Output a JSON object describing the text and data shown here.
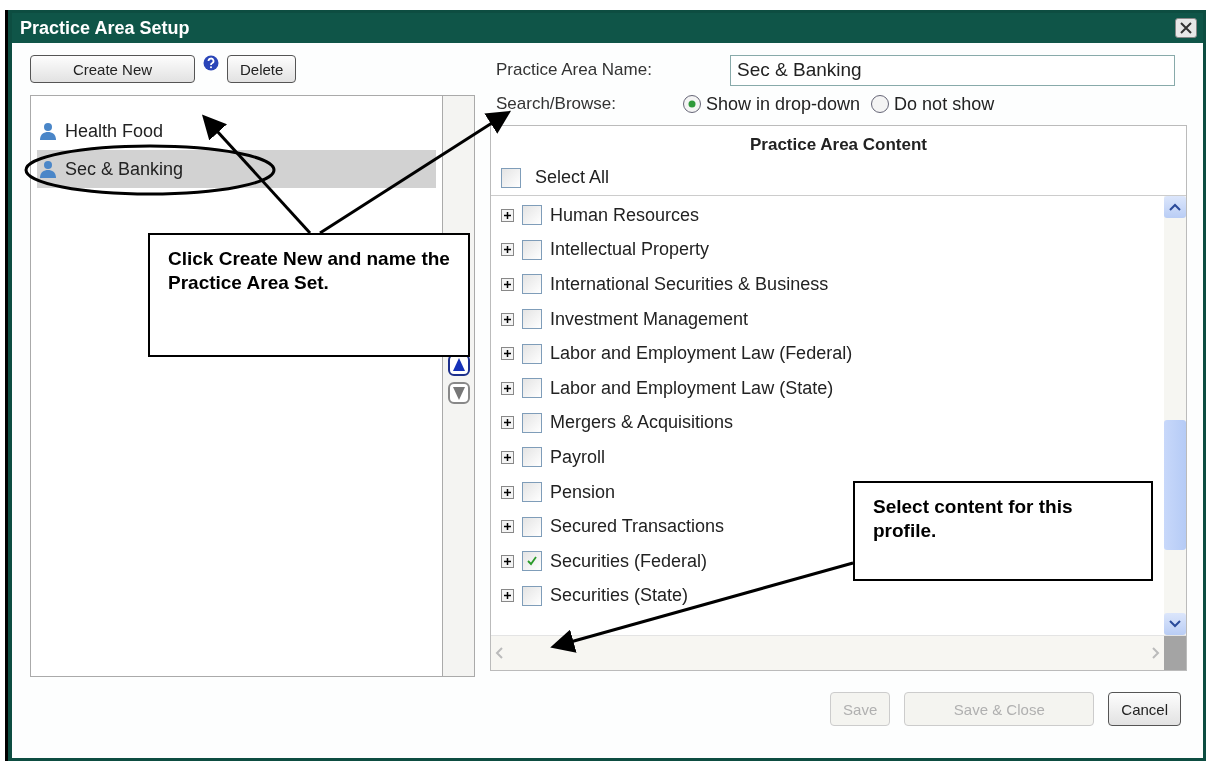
{
  "window": {
    "title": "Practice Area Setup"
  },
  "toolbar": {
    "create_button": "Create New",
    "delete_button": "Delete"
  },
  "profiles": [
    {
      "name": "Health Food",
      "selected": false
    },
    {
      "name": "Sec & Banking",
      "selected": true
    }
  ],
  "form": {
    "name_label": "Practice Area Name:",
    "name_value": "Sec & Banking",
    "search_label": "Search/Browse:",
    "options": [
      {
        "label": "Show in drop-down",
        "selected": true
      },
      {
        "label": "Do not show",
        "selected": false
      }
    ]
  },
  "content": {
    "title": "Practice Area Content",
    "select_all": {
      "label": "Select All",
      "checked": false
    },
    "items": [
      {
        "label": "Human Resources",
        "checked": false
      },
      {
        "label": "Intellectual Property",
        "checked": false
      },
      {
        "label": "International Securities & Business",
        "checked": false
      },
      {
        "label": "Investment Management",
        "checked": false
      },
      {
        "label": "Labor and Employment Law (Federal)",
        "checked": false
      },
      {
        "label": "Labor and Employment Law (State)",
        "checked": false
      },
      {
        "label": "Mergers & Acquisitions",
        "checked": false
      },
      {
        "label": "Payroll",
        "checked": false
      },
      {
        "label": "Pension",
        "checked": false
      },
      {
        "label": "Secured Transactions",
        "checked": false
      },
      {
        "label": "Securities (Federal)",
        "checked": true
      },
      {
        "label": "Securities (State)",
        "checked": false
      }
    ]
  },
  "buttons": [
    {
      "label": "Save",
      "disabled": true
    },
    {
      "label": "Save & Close",
      "disabled": true
    },
    {
      "label": "Cancel",
      "disabled": false
    }
  ],
  "callouts": [
    {
      "text": "Click Create New and name the Practice Area Set."
    },
    {
      "text": "Select content for this profile."
    }
  ]
}
